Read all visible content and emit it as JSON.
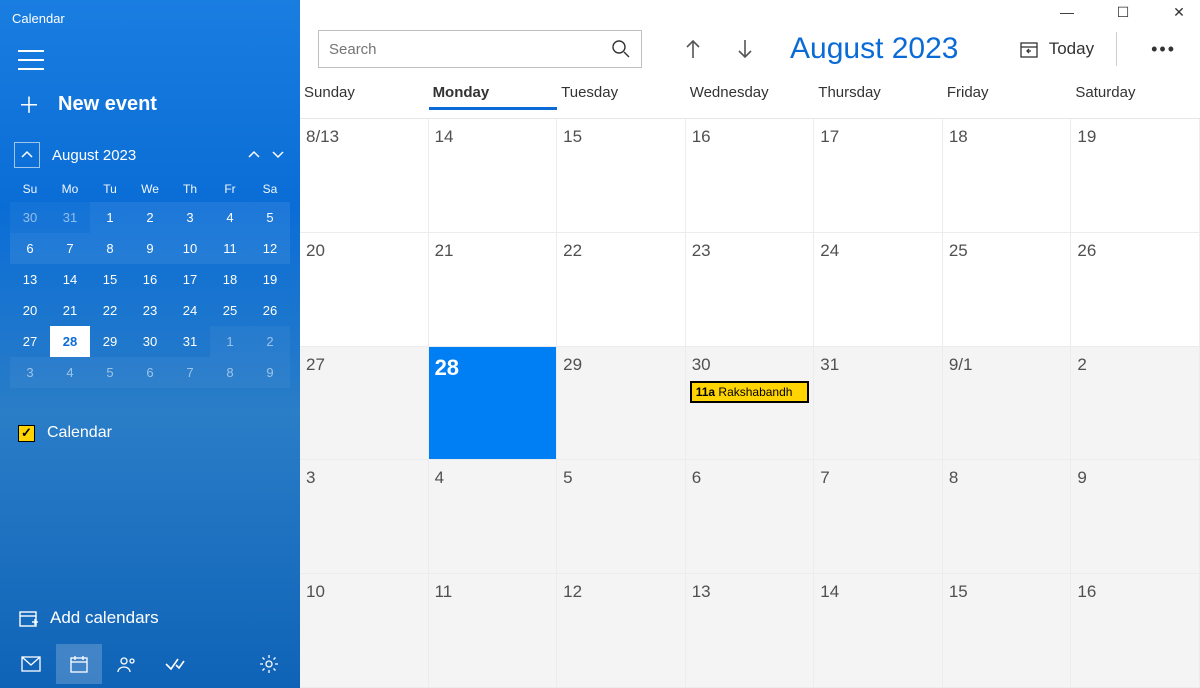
{
  "app_title": "Calendar",
  "new_event_label": "New event",
  "mini_month_label": "August 2023",
  "mini_dow": [
    "Su",
    "Mo",
    "Tu",
    "We",
    "Th",
    "Fr",
    "Sa"
  ],
  "mini_days": [
    {
      "n": "30",
      "fade": true,
      "bg1": true
    },
    {
      "n": "31",
      "fade": true,
      "bg1": true
    },
    {
      "n": "1",
      "bg1": true
    },
    {
      "n": "2",
      "bg1": true
    },
    {
      "n": "3",
      "bg1": true
    },
    {
      "n": "4",
      "bg1": true
    },
    {
      "n": "5",
      "bg1": true
    },
    {
      "n": "6",
      "bg1": true
    },
    {
      "n": "7",
      "bg1": true
    },
    {
      "n": "8",
      "bg1": true
    },
    {
      "n": "9",
      "bg1": true
    },
    {
      "n": "10",
      "bg1": true
    },
    {
      "n": "11",
      "bg1": true
    },
    {
      "n": "12",
      "bg1": true
    },
    {
      "n": "13"
    },
    {
      "n": "14"
    },
    {
      "n": "15"
    },
    {
      "n": "16"
    },
    {
      "n": "17"
    },
    {
      "n": "18"
    },
    {
      "n": "19"
    },
    {
      "n": "20"
    },
    {
      "n": "21"
    },
    {
      "n": "22"
    },
    {
      "n": "23"
    },
    {
      "n": "24"
    },
    {
      "n": "25"
    },
    {
      "n": "26"
    },
    {
      "n": "27"
    },
    {
      "n": "28",
      "today": true,
      "sel": true
    },
    {
      "n": "29"
    },
    {
      "n": "30"
    },
    {
      "n": "31"
    },
    {
      "n": "1",
      "fade": true,
      "bg1": true
    },
    {
      "n": "2",
      "fade": true,
      "bg1": true
    },
    {
      "n": "3",
      "fade": true,
      "bg1": true
    },
    {
      "n": "4",
      "fade": true,
      "bg1": true
    },
    {
      "n": "5",
      "fade": true,
      "bg1": true
    },
    {
      "n": "6",
      "fade": true,
      "bg1": true
    },
    {
      "n": "7",
      "fade": true,
      "bg1": true
    },
    {
      "n": "8",
      "fade": true,
      "bg1": true
    },
    {
      "n": "9",
      "fade": true,
      "bg1": true
    }
  ],
  "calendar_checkbox_label": "Calendar",
  "add_calendars_label": "Add calendars",
  "search_placeholder": "Search",
  "main_month_label": "August 2023",
  "today_button_label": "Today",
  "main_dow": [
    "Sunday",
    "Monday",
    "Tuesday",
    "Wednesday",
    "Thursday",
    "Friday",
    "Saturday"
  ],
  "main_dow_active_index": 1,
  "main_cells": [
    {
      "n": "8/13"
    },
    {
      "n": "14"
    },
    {
      "n": "15"
    },
    {
      "n": "16"
    },
    {
      "n": "17"
    },
    {
      "n": "18"
    },
    {
      "n": "19"
    },
    {
      "n": "20"
    },
    {
      "n": "21"
    },
    {
      "n": "22"
    },
    {
      "n": "23"
    },
    {
      "n": "24"
    },
    {
      "n": "25"
    },
    {
      "n": "26"
    },
    {
      "n": "27",
      "other": true
    },
    {
      "n": "28",
      "today": true
    },
    {
      "n": "29",
      "other": true
    },
    {
      "n": "30",
      "other": true,
      "event": {
        "time": "11a",
        "title": "Rakshabandh"
      }
    },
    {
      "n": "31",
      "other": true
    },
    {
      "n": "9/1",
      "other": true
    },
    {
      "n": "2",
      "other": true
    },
    {
      "n": "3",
      "other": true
    },
    {
      "n": "4",
      "other": true
    },
    {
      "n": "5",
      "other": true
    },
    {
      "n": "6",
      "other": true
    },
    {
      "n": "7",
      "other": true
    },
    {
      "n": "8",
      "other": true
    },
    {
      "n": "9",
      "other": true
    },
    {
      "n": "10",
      "other": true
    },
    {
      "n": "11",
      "other": true
    },
    {
      "n": "12",
      "other": true
    },
    {
      "n": "13",
      "other": true
    },
    {
      "n": "14",
      "other": true
    },
    {
      "n": "15",
      "other": true
    },
    {
      "n": "16",
      "other": true
    }
  ]
}
